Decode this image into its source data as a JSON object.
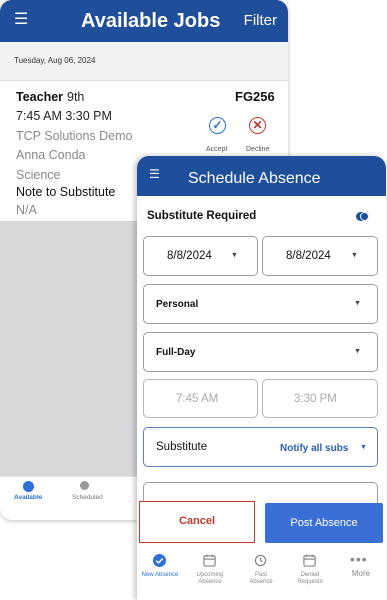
{
  "jobs_screen": {
    "title": "Available Jobs",
    "filter_label": "Filter",
    "date": "Tuesday, Aug 06, 2024",
    "job": {
      "role": "Teacher",
      "grade": "9th",
      "code": "FG256",
      "time": "7:45 AM 3:30 PM",
      "organization": "TCP Solutions Demo",
      "person": "Anna Conda",
      "subject": "Science",
      "note_heading": "Note to Substitute",
      "note": "N/A",
      "accept_label": "Accept",
      "decline_label": "Decline"
    },
    "tabs": [
      {
        "label": "Available"
      },
      {
        "label": "Scheduled"
      }
    ]
  },
  "absence_screen": {
    "title": "Schedule Absence",
    "substitute_required_label": "Substitute Required",
    "start_date": "8/8/2024",
    "end_date": "8/8/2024",
    "reason": "Personal",
    "duration": "Full-Day",
    "start_time": "7:45 AM",
    "end_time": "3:30 PM",
    "substitute_label": "Substitute",
    "substitute_option": "Notify all subs",
    "cancel_label": "Cancel",
    "post_label": "Post Absence",
    "tabs": [
      {
        "label": "New Absence"
      },
      {
        "label": "Upcoming Absence"
      },
      {
        "label": "Past Absence"
      },
      {
        "label": "Denied Requests"
      },
      {
        "label": "More"
      }
    ]
  },
  "colors": {
    "header_blue": "#1f4e9b",
    "accept_blue": "#2f6fd8",
    "decline_red": "#c0392b",
    "post_button_blue": "#3a6fd6"
  }
}
